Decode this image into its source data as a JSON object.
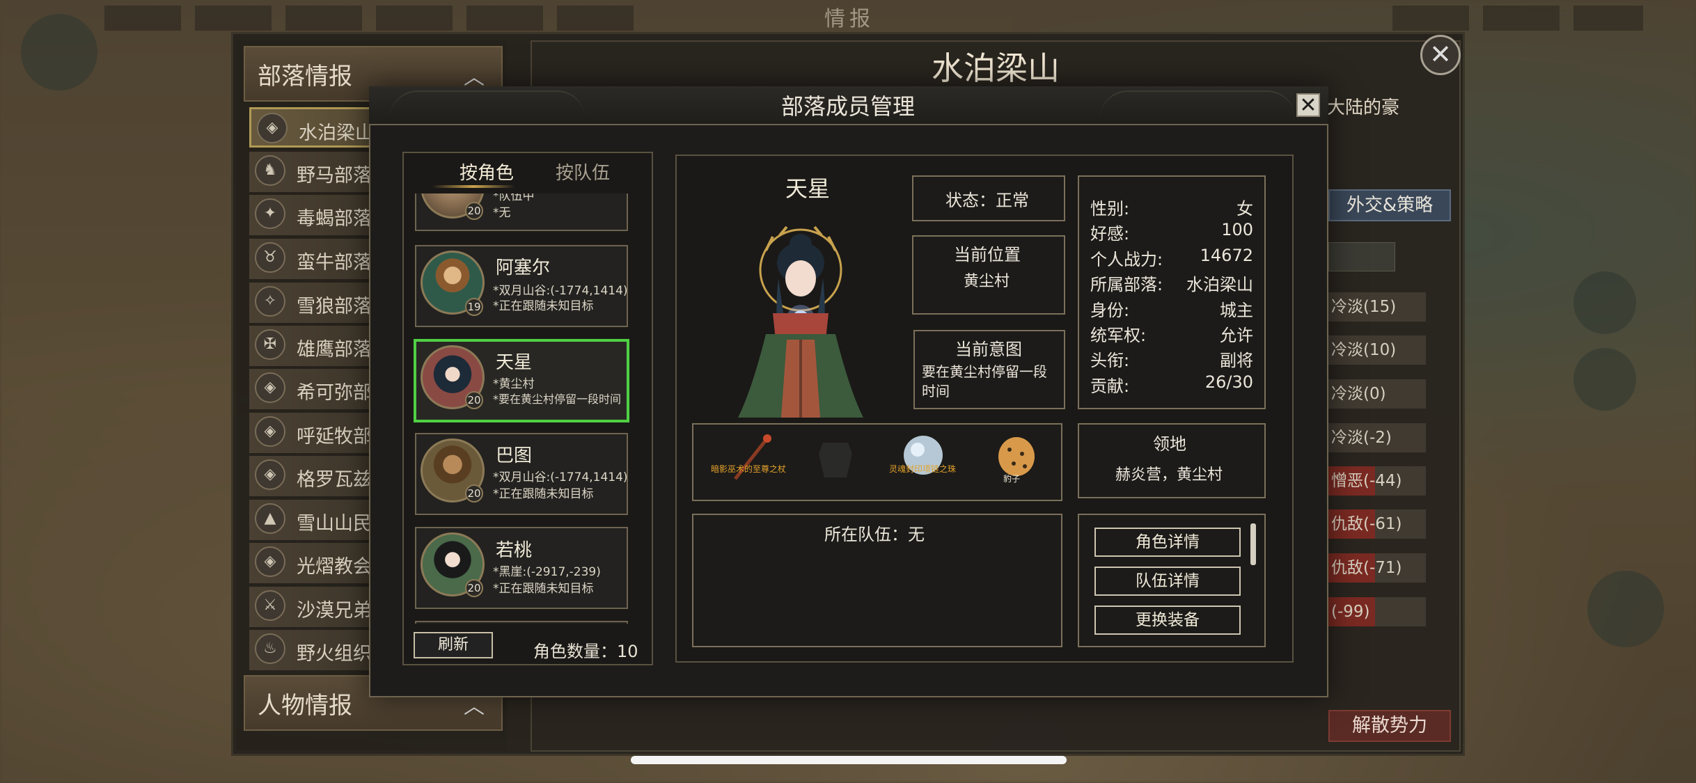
{
  "screen": {
    "title": "情报"
  },
  "intel": {
    "tribe_section_label": "部落情报",
    "person_section_label": "人物情报",
    "tribes": [
      {
        "name": "水泊梁山",
        "selected": true
      },
      {
        "name": "野马部落"
      },
      {
        "name": "毒蝎部落"
      },
      {
        "name": "蛮牛部落"
      },
      {
        "name": "雪狼部落"
      },
      {
        "name": "雄鹰部落"
      },
      {
        "name": "希可弥部"
      },
      {
        "name": "呼延牧部"
      },
      {
        "name": "格罗瓦兹部"
      },
      {
        "name": "雪山山民"
      },
      {
        "name": "光熠教会"
      },
      {
        "name": "沙漠兄弟"
      },
      {
        "name": "野火组织"
      }
    ],
    "clan_title": "水泊梁山",
    "clan_desc": "大陆的豪",
    "diplomacy_button": "外交&策略",
    "relations": [
      "冷淡(15)",
      "冷淡(10)",
      "冷淡(0)",
      "冷淡(-2)",
      "憎恶(-44)",
      "仇敌(-61)",
      "仇敌(-71)",
      "(-99)"
    ],
    "disband_button": "解散势力"
  },
  "modal": {
    "title": "部落成员管理",
    "tabs": [
      "按角色",
      "按队伍"
    ],
    "members": [
      {
        "name": "",
        "level": "20",
        "line1": "*队伍中",
        "line2": "*无"
      },
      {
        "name": "阿塞尔",
        "level": "19",
        "line1": "*双月山谷:(-1774,1414)",
        "line2": "*正在跟随未知目标"
      },
      {
        "name": "天星",
        "level": "20",
        "line1": "*黄尘村",
        "line2": "*要在黄尘村停留一段时间",
        "selected": true
      },
      {
        "name": "巴图",
        "level": "20",
        "line1": "*双月山谷:(-1774,1414)",
        "line2": "*正在跟随未知目标"
      },
      {
        "name": "若桃",
        "level": "20",
        "line1": "*黑崖:(-2917,-239)",
        "line2": "*正在跟随未知目标"
      }
    ],
    "refresh_button": "刷新",
    "count_label": "角色数量：10",
    "detail": {
      "name": "天星",
      "status": "状态：正常",
      "location_label": "当前位置",
      "location_value": "黄尘村",
      "intent_label": "当前意图",
      "intent_value": "要在黄尘村停留一段时间",
      "stats": [
        {
          "k": "性别:",
          "v": "女"
        },
        {
          "k": "好感:",
          "v": "100"
        },
        {
          "k": "个人战力:",
          "v": "14672"
        },
        {
          "k": "所属部落:",
          "v": "水泊梁山"
        },
        {
          "k": "身份:",
          "v": "城主"
        },
        {
          "k": "统军权:",
          "v": "允许"
        },
        {
          "k": "头衔:",
          "v": "副将"
        },
        {
          "k": "贡献:",
          "v": "26/30"
        }
      ],
      "equipment": [
        "暗影巫术的至尊之杖",
        "",
        "灵魂封印项链之珠",
        "豹子"
      ],
      "territory_label": "领地",
      "territory_value": "赫炎营，黄尘村",
      "team_label": "所在队伍：无",
      "actions": [
        "角色详情",
        "队伍详情",
        "更换装备"
      ]
    }
  },
  "colors": {
    "accent_gold": "#c9a24e",
    "selected_green": "#4fd043",
    "warning_orange": "#e3a12a"
  }
}
